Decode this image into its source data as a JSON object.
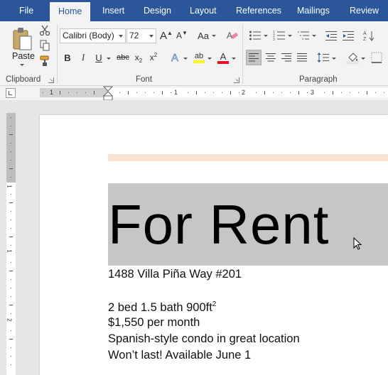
{
  "tabs": [
    "File",
    "Home",
    "Insert",
    "Design",
    "Layout",
    "References",
    "Mailings",
    "Review"
  ],
  "active_tab": "Home",
  "colors": {
    "tab_bar": "#2b579a",
    "ribbon": "#f3f3f3",
    "highlight_yellow": "#ffff00",
    "font_color_red": "#e81123",
    "page_border_peach": "#fbe4d5",
    "title_highlight": "#c6c6c6"
  },
  "clipboard": {
    "paste_label": "Paste",
    "group_label": "Clipboard",
    "icons": [
      "cut-icon",
      "copy-icon",
      "format-painter-icon"
    ]
  },
  "font": {
    "family": "Calibri (Body)",
    "size": "72",
    "group_label": "Font",
    "change_case_label": "Aa",
    "grow_label": "A",
    "shrink_label": "A",
    "bold": "B",
    "italic": "I",
    "underline": "U",
    "strike": "abc",
    "subscript": "x",
    "subscript_mark": "2",
    "superscript": "x",
    "superscript_mark": "2",
    "text_effects": "A",
    "highlight_label": "ab",
    "font_color_label": "A"
  },
  "paragraph": {
    "group_label": "Paragraph",
    "icons": [
      "bullets-icon",
      "numbering-icon",
      "multilevel-list-icon",
      "decrease-indent-icon",
      "increase-indent-icon",
      "sort-icon",
      "align-left-icon",
      "align-center-icon",
      "align-right-icon",
      "justify-icon",
      "line-spacing-icon",
      "shading-icon",
      "borders-icon"
    ]
  },
  "ruler": {
    "h_numbers": [
      "1",
      "1",
      "2",
      "3"
    ],
    "v_numbers": [
      "1",
      "1",
      "2"
    ]
  },
  "document": {
    "title": "For Rent",
    "address": "1488 Villa Piña Way #201",
    "specs": "2 bed 1.5 bath 900ft",
    "specs_sup": "2",
    "price": "$1,550 per month",
    "description": "Spanish-style condo in great location",
    "availability": "Won’t last! Available June 1"
  }
}
